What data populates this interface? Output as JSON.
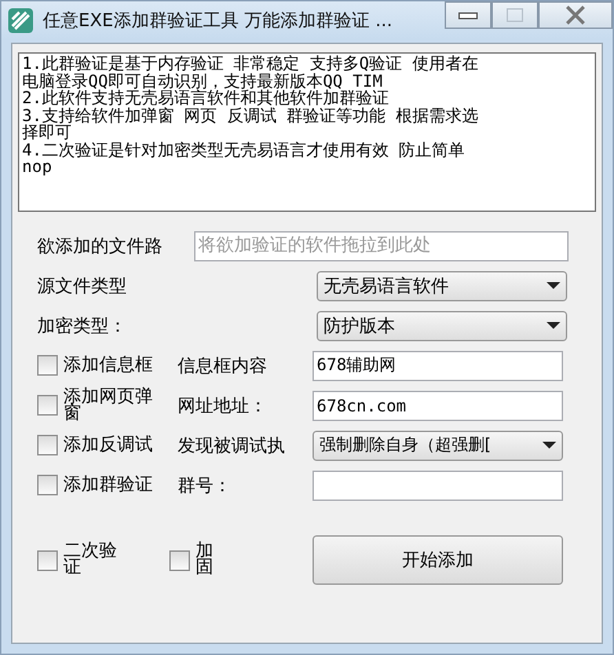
{
  "window": {
    "title": "任意EXE添加群验证工具  万能添加群验证 ...",
    "maximize_disabled": true
  },
  "notes": [
    "1.此群验证是基于内存验证 非常稳定 支持多Q验证 使用者在",
    "电脑登录QQ即可自动识别，支持最新版本QQ TIM",
    "2.此软件支持无壳易语言软件和其他软件加群验证",
    "3.支持给软件加弹窗 网页 反调试 群验证等功能 根据需求选",
    "择即可",
    "4.二次验证是针对加密类型无壳易语言才使用有效 防止简单",
    "nop"
  ],
  "file_path": {
    "label": "欲添加的文件路",
    "placeholder": "将欲加验证的软件拖拉到此处"
  },
  "source_type": {
    "label": "源文件类型",
    "value": "无壳易语言软件"
  },
  "encryption": {
    "label": "加密类型：",
    "value": "防护版本"
  },
  "options": [
    {
      "checkbox": "添加信息框",
      "checked": false,
      "label": "信息框内容",
      "kind": "text",
      "value": "678辅助网"
    },
    {
      "checkbox": "添加网页弹窗",
      "checked": false,
      "label": "网址地址：",
      "kind": "text",
      "value": "678cn.com"
    },
    {
      "checkbox": "添加反调试",
      "checked": false,
      "label": "发现被调试执",
      "kind": "combo",
      "value": "强制删除自身（超强删["
    },
    {
      "checkbox": "添加群验证",
      "checked": false,
      "label": "群号：",
      "kind": "text"
    }
  ],
  "extras": [
    {
      "label": "二次验证",
      "checked": false
    },
    {
      "label": "加固",
      "checked": false
    }
  ],
  "start_button": "开始添加"
}
